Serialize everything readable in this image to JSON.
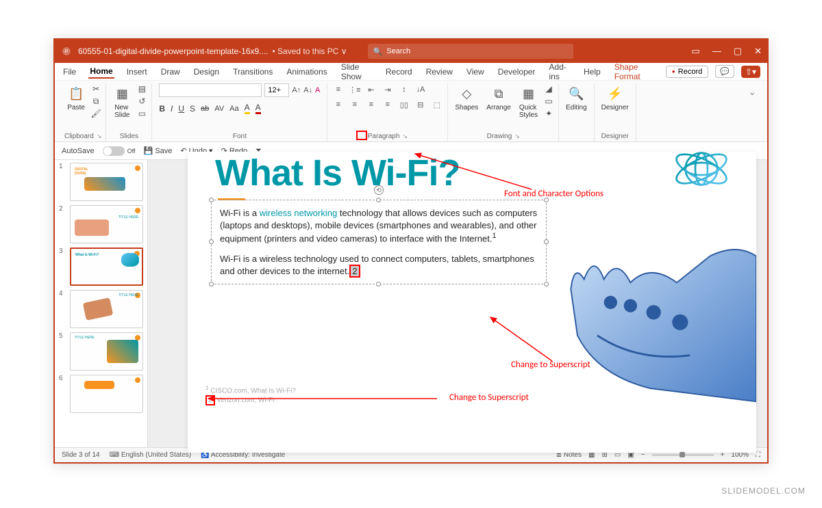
{
  "title": {
    "docname": "60555-01-digital-divide-powerpoint-template-16x9....",
    "saved": "• Saved to this PC ∨",
    "search": "Search"
  },
  "tabs": {
    "file": "File",
    "home": "Home",
    "insert": "Insert",
    "draw": "Draw",
    "design": "Design",
    "transitions": "Transitions",
    "animations": "Animations",
    "slideshow": "Slide Show",
    "record": "Record",
    "review": "Review",
    "view": "View",
    "developer": "Developer",
    "addins": "Add-ins",
    "help": "Help",
    "shapefmt": "Shape Format",
    "recordbtn": "Record"
  },
  "ribbon": {
    "paste": "Paste",
    "clipboard": "Clipboard",
    "newslide": "New\nSlide",
    "slides": "Slides",
    "fontsize": "12+",
    "font": "Font",
    "B": "B",
    "I": "I",
    "U": "U",
    "S": "S",
    "ab": "ab",
    "AV": "AV",
    "Aa": "Aa",
    "paragraph": "Paragraph",
    "shapes": "Shapes",
    "arrange": "Arrange",
    "quick": "Quick\nStyles",
    "drawing": "Drawing",
    "editing": "Editing",
    "designer": "Designer"
  },
  "qat": {
    "autosave": "AutoSave",
    "off": "Off",
    "save": "Save",
    "undo": "Undo",
    "redo": "Redo"
  },
  "slide": {
    "title": "What Is Wi-Fi?",
    "p1a": "Wi-Fi is a ",
    "p1link": "wireless networking",
    "p1b": " technology that allows devices such as computers (laptops and desktops), mobile devices (smartphones and wearables), and other equipment (printers and video cameras) to interface with the Internet.",
    "sup1": "1",
    "p2": "Wi-Fi is a wireless technology used to connect computers, tablets, smartphones and other devices to the internet.",
    "sup2": "2",
    "fn1": " CISCO.com, What Is Wi-Fi?",
    "fn1n": "1",
    "fn2": " Verizon.com, Wi-Fi",
    "fn2n": "2"
  },
  "annotations": {
    "fontopts": "Font and Character Options",
    "changesuper1": "Change to Superscript",
    "changesuper2": "Change to Superscript"
  },
  "status": {
    "slide": "Slide 3 of 14",
    "lang": "English (United States)",
    "access": "Accessibility: Investigate",
    "notes": "Notes",
    "zoom": "100%"
  },
  "thumbs": {
    "n1": "1",
    "n2": "2",
    "n3": "3",
    "n4": "4",
    "n5": "5",
    "n6": "6"
  },
  "watermark": "SLIDEMODEL.COM"
}
